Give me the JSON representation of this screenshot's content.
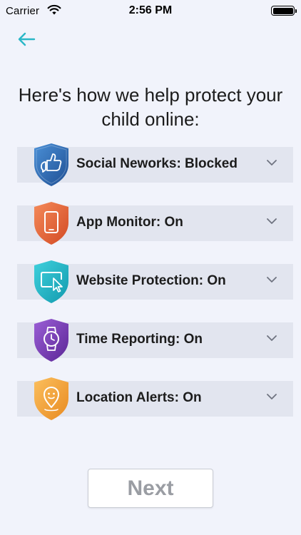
{
  "status_bar": {
    "carrier": "Carrier",
    "time": "2:56 PM"
  },
  "header": {
    "back_icon": "arrow-left-icon",
    "accent_color": "#2bb7c7"
  },
  "title": "Here's how we help protect your child online:",
  "features": [
    {
      "label": "Social Neworks: Blocked",
      "icon": "thumbs-up-chat-icon",
      "color": "#2f6fb5"
    },
    {
      "label": "App Monitor: On",
      "icon": "phone-icon",
      "color": "#e8643a"
    },
    {
      "label": "Website Protection: On",
      "icon": "screen-cursor-icon",
      "color": "#1fb2c4"
    },
    {
      "label": "Time Reporting: On",
      "icon": "watch-icon",
      "color": "#7a3fb8"
    },
    {
      "label": "Location Alerts: On",
      "icon": "location-person-icon",
      "color": "#f3a037"
    }
  ],
  "next_button": {
    "label": "Next"
  }
}
